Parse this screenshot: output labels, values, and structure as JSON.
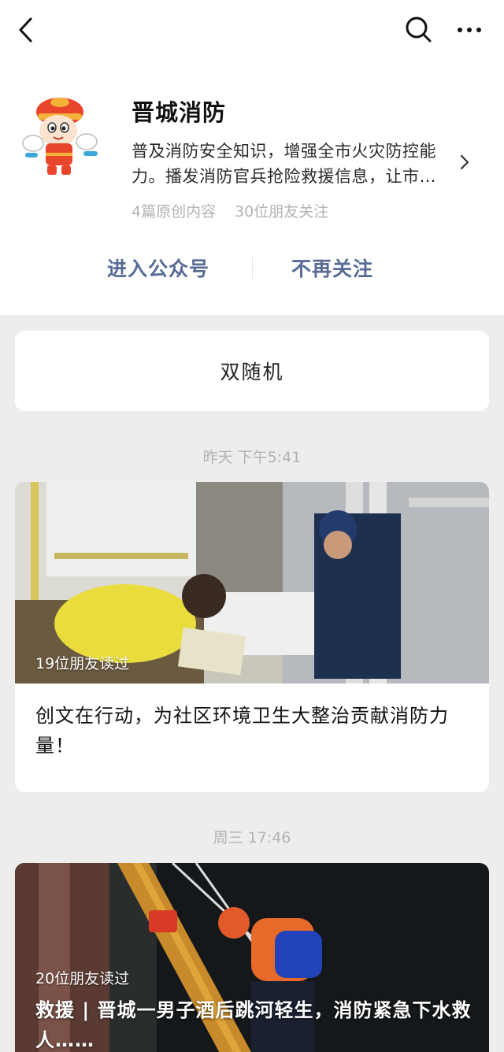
{
  "account": {
    "name": "晋城消防",
    "description": "普及消防安全知识，增强全市火灾防控能力。播发消防官兵抢险救援信息，让市…",
    "original_count": "4篇原创内容",
    "friends_following": "30位朋友关注"
  },
  "actions": {
    "enter": "进入公众号",
    "unfollow": "不再关注"
  },
  "random_card": {
    "label": "双随机"
  },
  "articles": [
    {
      "timestamp": "昨天 下午5:41",
      "reads": "19位朋友读过",
      "title": "创文在行动，为社区环境卫生大整治贡献消防力量！"
    },
    {
      "timestamp": "周三 17:46",
      "reads": "20位朋友读过",
      "title": "救援 | 晋城一男子酒后跳河轻生，消防紧急下水救人……"
    }
  ],
  "icons": {
    "back": "chevron-left-icon",
    "search": "search-icon",
    "more": "more-dots-icon",
    "detail": "chevron-right-icon"
  },
  "colors": {
    "link": "#576b95",
    "muted": "#b2b2b2",
    "background": "#ededed"
  }
}
